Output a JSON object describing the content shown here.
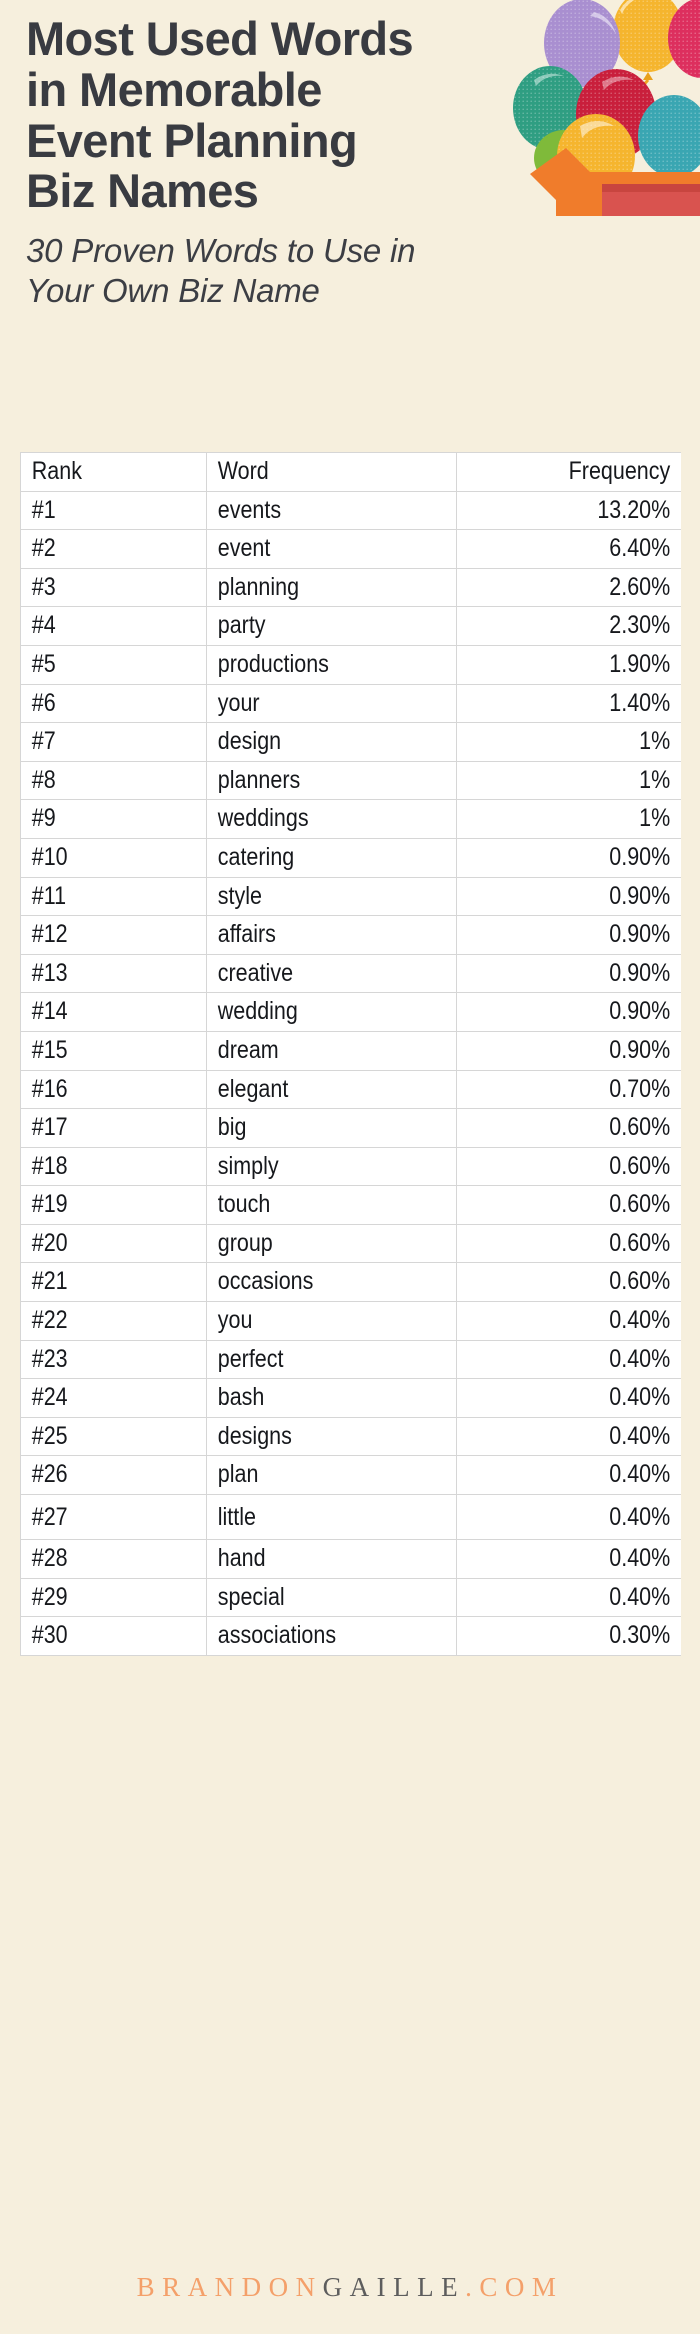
{
  "page": {
    "background_color": "#f6efdd",
    "title": "Most Used Words\nin Memorable\nEvent Planning\nBiz Names",
    "subtitle": "30 Proven Words to Use in\nYour Own Biz Name",
    "title_color": "#393b41"
  },
  "illustration": {
    "name": "balloons-in-open-box",
    "box_color": "#f07c2b",
    "box_shadow_color": "#d9534f",
    "balloon_colors": [
      "#a98fd0",
      "#f5b52e",
      "#d9264a",
      "#2f9e82",
      "#c91f3c",
      "#f5b52e",
      "#3aa6b2",
      "#7fba3a"
    ]
  },
  "table": {
    "columns": [
      "Rank",
      "Word",
      "Frequency"
    ],
    "rows": [
      {
        "rank": "#1",
        "word": "events",
        "frequency": "13.20%"
      },
      {
        "rank": "#2",
        "word": "event",
        "frequency": "6.40%"
      },
      {
        "rank": "#3",
        "word": "planning",
        "frequency": "2.60%"
      },
      {
        "rank": "#4",
        "word": "party",
        "frequency": "2.30%"
      },
      {
        "rank": "#5",
        "word": "productions",
        "frequency": "1.90%"
      },
      {
        "rank": "#6",
        "word": "your",
        "frequency": "1.40%"
      },
      {
        "rank": "#7",
        "word": "design",
        "frequency": "1%"
      },
      {
        "rank": "#8",
        "word": "planners",
        "frequency": "1%"
      },
      {
        "rank": "#9",
        "word": "weddings",
        "frequency": "1%"
      },
      {
        "rank": "#10",
        "word": "catering",
        "frequency": "0.90%"
      },
      {
        "rank": "#11",
        "word": "style",
        "frequency": "0.90%"
      },
      {
        "rank": "#12",
        "word": "affairs",
        "frequency": "0.90%"
      },
      {
        "rank": "#13",
        "word": "creative",
        "frequency": "0.90%"
      },
      {
        "rank": "#14",
        "word": "wedding",
        "frequency": "0.90%"
      },
      {
        "rank": "#15",
        "word": "dream",
        "frequency": "0.90%"
      },
      {
        "rank": "#16",
        "word": "elegant",
        "frequency": "0.70%"
      },
      {
        "rank": "#17",
        "word": "big",
        "frequency": "0.60%"
      },
      {
        "rank": "#18",
        "word": "simply",
        "frequency": "0.60%"
      },
      {
        "rank": "#19",
        "word": "touch",
        "frequency": "0.60%"
      },
      {
        "rank": "#20",
        "word": "group",
        "frequency": "0.60%"
      },
      {
        "rank": "#21",
        "word": "occasions",
        "frequency": "0.60%"
      },
      {
        "rank": "#22",
        "word": "you",
        "frequency": "0.40%"
      },
      {
        "rank": "#23",
        "word": "perfect",
        "frequency": "0.40%"
      },
      {
        "rank": "#24",
        "word": "bash",
        "frequency": "0.40%"
      },
      {
        "rank": "#25",
        "word": "designs",
        "frequency": "0.40%"
      },
      {
        "rank": "#26",
        "word": "plan",
        "frequency": "0.40%"
      },
      {
        "rank": "#27",
        "word": "little",
        "frequency": "0.40%"
      },
      {
        "rank": "#28",
        "word": "hand",
        "frequency": "0.40%"
      },
      {
        "rank": "#29",
        "word": "special",
        "frequency": "0.40%"
      },
      {
        "rank": "#30",
        "word": "associations",
        "frequency": "0.30%"
      }
    ]
  },
  "footer": {
    "brand_part1": "BRANDON",
    "brand_part2": "GAILLE",
    "brand_part3": ".COM",
    "color_accent": "#f4a06a",
    "color_neutral": "#5d5d5d"
  },
  "chart_data": {
    "type": "table",
    "title": "Most Used Words in Memorable Event Planning Biz Names",
    "subtitle": "30 Proven Words to Use in Your Own Biz Name",
    "columns": [
      "Rank",
      "Word",
      "Frequency"
    ],
    "categories": [
      "events",
      "event",
      "planning",
      "party",
      "productions",
      "your",
      "design",
      "planners",
      "weddings",
      "catering",
      "style",
      "affairs",
      "creative",
      "wedding",
      "dream",
      "elegant",
      "big",
      "simply",
      "touch",
      "group",
      "occasions",
      "you",
      "perfect",
      "bash",
      "designs",
      "plan",
      "little",
      "hand",
      "special",
      "associations"
    ],
    "values": [
      13.2,
      6.4,
      2.6,
      2.3,
      1.9,
      1.4,
      1.0,
      1.0,
      1.0,
      0.9,
      0.9,
      0.9,
      0.9,
      0.9,
      0.9,
      0.7,
      0.6,
      0.6,
      0.6,
      0.6,
      0.6,
      0.4,
      0.4,
      0.4,
      0.4,
      0.4,
      0.4,
      0.4,
      0.4,
      0.3
    ],
    "xlabel": "Word",
    "ylabel": "Frequency (%)",
    "ylim": [
      0,
      13.2
    ]
  }
}
